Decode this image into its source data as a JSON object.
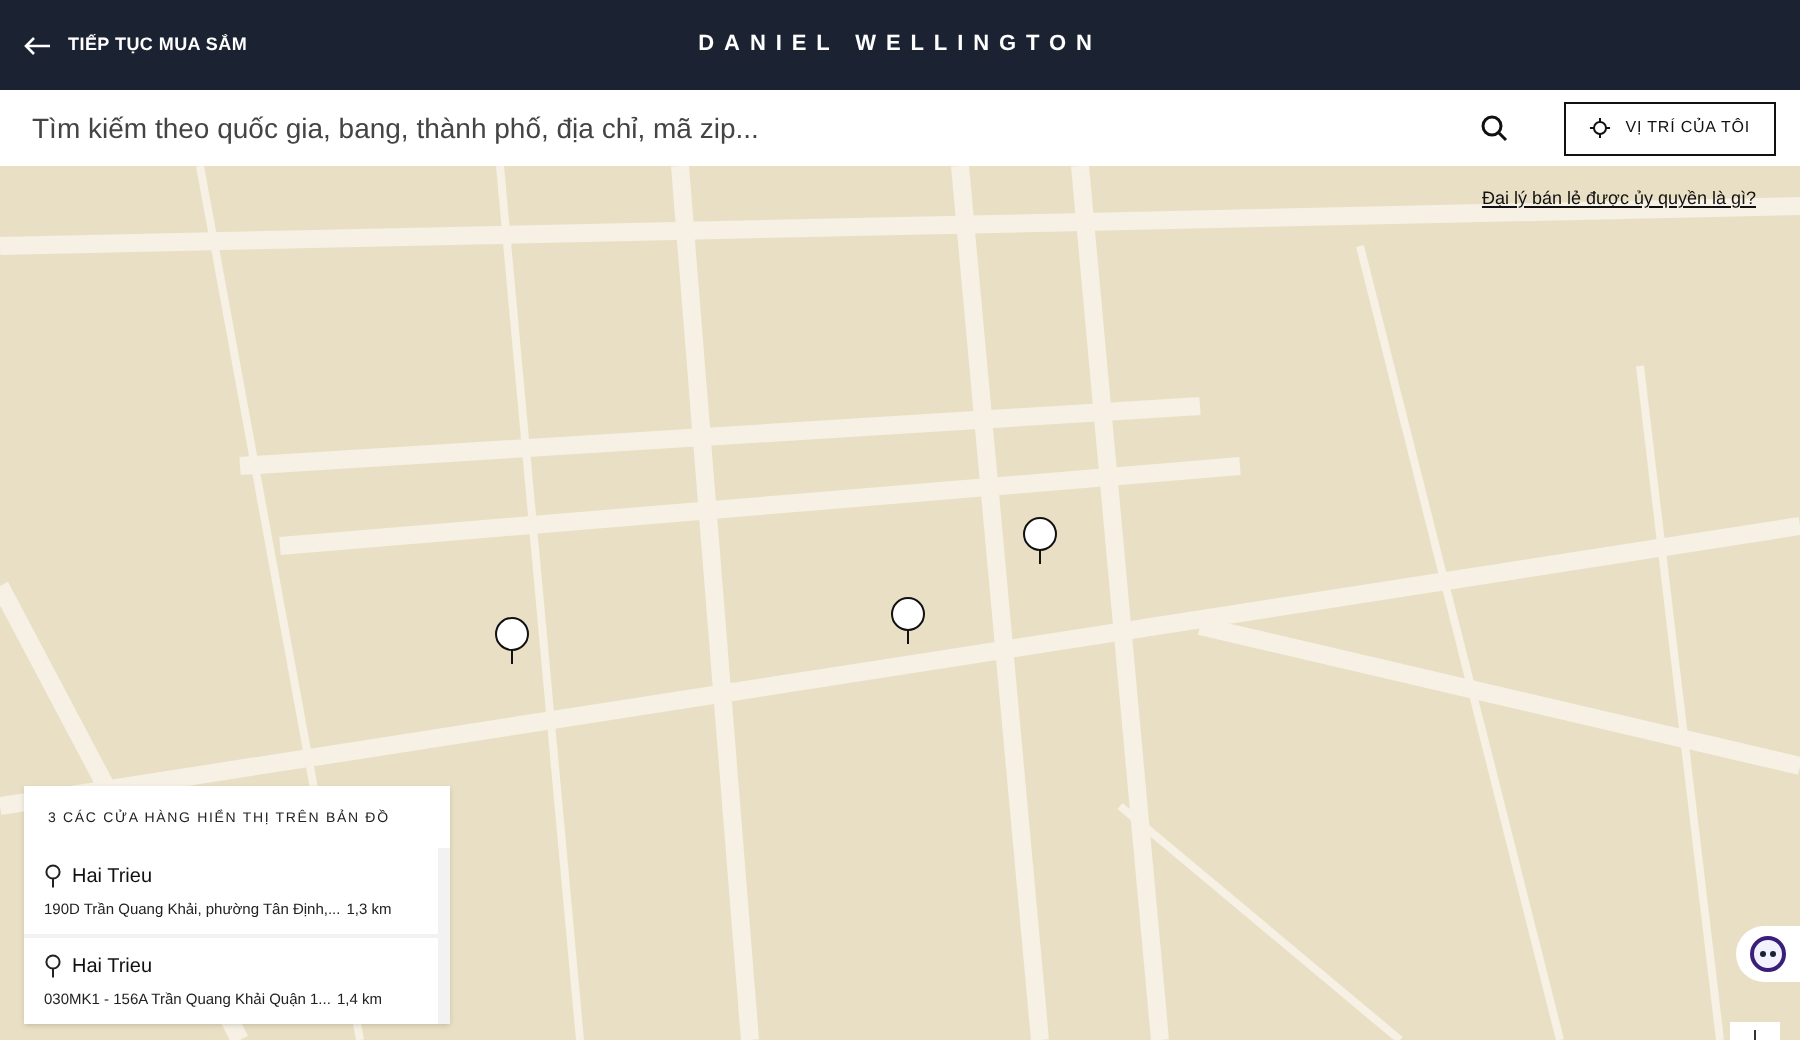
{
  "header": {
    "back_link": "TIẾP TỤC MUA SẮM",
    "brand": "DANIEL WELLINGTON"
  },
  "search": {
    "placeholder": "Tìm kiếm theo quốc gia, bang, thành phố, địa chỉ, mã zip...",
    "location_button": "VỊ TRÍ CỦA TÔI"
  },
  "map": {
    "info_link": "Đại lý bán lẻ được ủy quyền là gì?"
  },
  "store_panel": {
    "title": "3 CÁC CỬA HÀNG HIỂN THỊ TRÊN BẢN ĐỒ",
    "stores": [
      {
        "name": "Hai Trieu",
        "address": "190D Trần Quang Khải, phường Tân Định,...",
        "distance": "1,3 km"
      },
      {
        "name": "Hai Trieu",
        "address": "030MK1 - 156A Trần Quang Khải Quận 1...",
        "distance": "1,4 km"
      }
    ]
  }
}
